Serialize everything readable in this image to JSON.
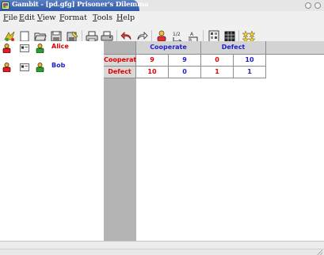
{
  "window": {
    "title": "Gambit - [pd.gfg] Prisoner's Dilemma"
  },
  "menu": [
    {
      "label": "File",
      "accel": "F",
      "rest": "ile"
    },
    {
      "label": "Edit",
      "accel": "E",
      "rest": "dit"
    },
    {
      "label": "View",
      "accel": "V",
      "rest": "iew"
    },
    {
      "label": "Format",
      "accel": "F",
      "rest": "ormat"
    },
    {
      "label": "Tools",
      "accel": "T",
      "rest": "ools"
    },
    {
      "label": "Help",
      "accel": "H",
      "rest": "elp"
    }
  ],
  "toolbar": {
    "icons": [
      "gambit-logo-icon",
      "new-icon",
      "open-icon",
      "save-icon",
      "save-as-icon",
      "print-preview-icon",
      "print-icon",
      "undo-icon",
      "redo-icon",
      "add-player-icon",
      "add-strategy-icon",
      "delete-strategy-icon",
      "profile-icon",
      "grid-icon",
      "equilibrium-icon"
    ]
  },
  "players": [
    {
      "name": "Alice",
      "color": "#e00000"
    },
    {
      "name": "Bob",
      "color": "#1c1cd0"
    }
  ],
  "game": {
    "column_player": "Bob",
    "row_player": "Alice",
    "column_strategies": [
      "Cooperate",
      "Defect"
    ],
    "row_strategies": [
      "Cooperate",
      "Defect"
    ],
    "payoffs": [
      [
        [
          "9",
          "9"
        ],
        [
          "0",
          "10"
        ]
      ],
      [
        [
          "10",
          "0"
        ],
        [
          "1",
          "1"
        ]
      ]
    ]
  },
  "colors": {
    "player1": "#e00000",
    "player2": "#1c1cd0",
    "title_bar": "#3f68b2"
  }
}
